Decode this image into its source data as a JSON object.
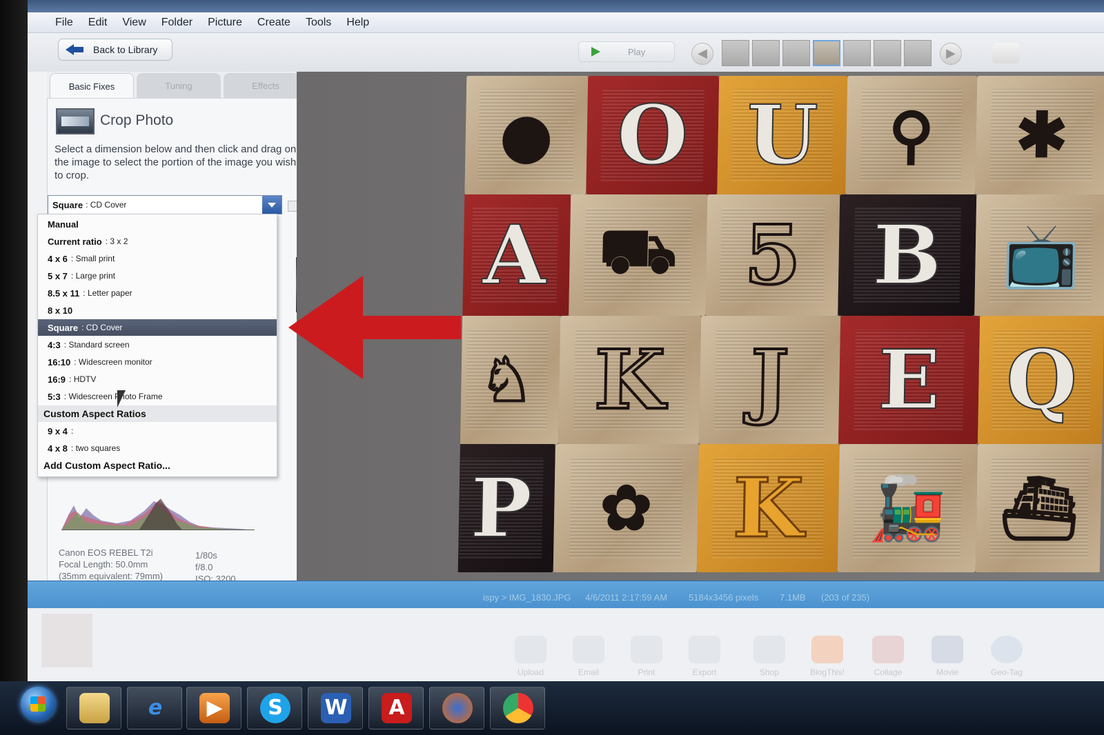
{
  "menubar": {
    "items": [
      "File",
      "Edit",
      "View",
      "Folder",
      "Picture",
      "Create",
      "Tools",
      "Help"
    ]
  },
  "toolbar": {
    "back_label": "Back to Library",
    "play_label": "Play"
  },
  "tabs": [
    "Basic Fixes",
    "Tuning",
    "Effects"
  ],
  "crop": {
    "title": "Crop Photo",
    "description": "Select a dimension below and then click and drag on the image to select the portion of the image you wish to crop.",
    "selected_key": "Square",
    "selected_sub": ": CD Cover"
  },
  "crop_options": [
    {
      "key": "Manual",
      "sub": ""
    },
    {
      "key": "Current ratio",
      "sub": ": 3 x 2"
    },
    {
      "key": "4 x 6",
      "sub": ": Small print"
    },
    {
      "key": "5 x 7",
      "sub": ": Large print"
    },
    {
      "key": "8.5 x 11",
      "sub": ": Letter paper"
    },
    {
      "key": "8 x 10",
      "sub": ""
    },
    {
      "key": "Square",
      "sub": ": CD Cover"
    },
    {
      "key": "4:3",
      "sub": ": Standard screen"
    },
    {
      "key": "16:10",
      "sub": ": Widescreen monitor"
    },
    {
      "key": "16:9",
      "sub": ": HDTV"
    },
    {
      "key": "5:3",
      "sub": ": Widescreen Photo Frame"
    },
    {
      "key": "Custom Aspect Ratios",
      "sub": ""
    },
    {
      "key": "9 x 4",
      "sub": ":"
    },
    {
      "key": "4 x 8",
      "sub": ": two squares"
    },
    {
      "key": "Add Custom Aspect Ratio...",
      "sub": ""
    }
  ],
  "exif": {
    "camera": "Canon EOS REBEL T2i",
    "focal": "Focal Length: 50.0mm",
    "equiv": "(35mm equivalent:  79mm)",
    "shutter": "1/80s",
    "aperture": "f/8.0",
    "iso": "ISO: 3200"
  },
  "status": {
    "path": "ispy > IMG_1830.JPG",
    "date": "4/6/2011 2:17:59 AM",
    "dims": "5184x3456 pixels",
    "size": "7.1MB",
    "count": "(203 of 235)"
  },
  "tray": [
    "Upload",
    "Email",
    "Print",
    "Export",
    "Shop",
    "BlogThis!",
    "Collage",
    "Movie",
    "Geo-Tag"
  ],
  "blocks": [
    [
      "apple",
      "O",
      "U",
      "rattle",
      "bee"
    ],
    [
      "A",
      "car",
      "5",
      "B",
      "tv"
    ],
    [
      "hen",
      "K",
      "J",
      "E",
      "Q"
    ],
    [
      "P",
      "flower",
      "K",
      "train",
      "boat"
    ]
  ],
  "colors": {
    "arrow": "#cc1b1f",
    "statusbar": "#4b92cf",
    "selected_item": "#4f586b"
  }
}
